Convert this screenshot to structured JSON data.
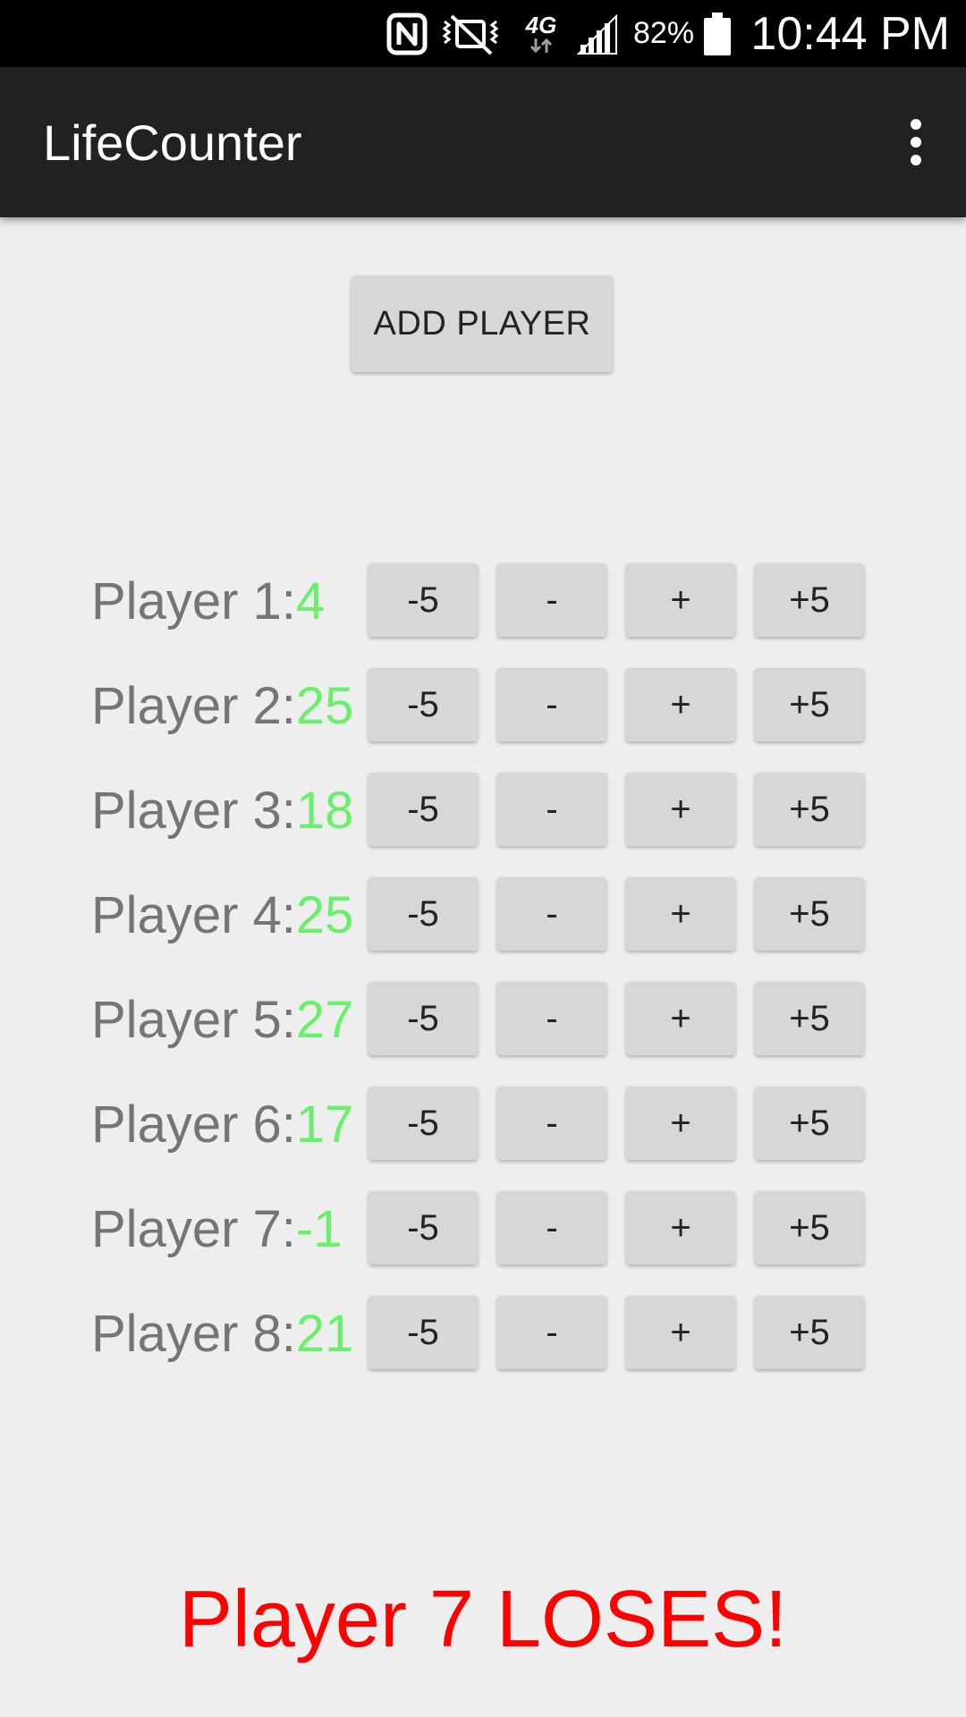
{
  "status_bar": {
    "battery_percent": "82%",
    "time": "10:44 PM",
    "icons": [
      "nfc-icon",
      "vibrate-icon",
      "network-4g-icon",
      "signal-icon",
      "battery-icon"
    ]
  },
  "app_bar": {
    "title": "LifeCounter",
    "overflow_icon": "more-vert-icon"
  },
  "add_player": {
    "label": "ADD PLAYER"
  },
  "buttons": {
    "minus_five": "-5",
    "minus_one": "-",
    "plus_one": "+",
    "plus_five": "+5"
  },
  "players": [
    {
      "label": "Player 1:",
      "life": "4"
    },
    {
      "label": "Player 2:",
      "life": "25"
    },
    {
      "label": "Player 3:",
      "life": "18"
    },
    {
      "label": "Player 4:",
      "life": "25"
    },
    {
      "label": "Player 5:",
      "life": "27"
    },
    {
      "label": "Player 6:",
      "life": "17"
    },
    {
      "label": "Player 7:",
      "life": "-1"
    },
    {
      "label": "Player 8:",
      "life": "21"
    }
  ],
  "loser_message": "Player 7 LOSES!",
  "colors": {
    "life_value": "#69f06a",
    "loser_text": "#ff0000",
    "app_bar": "#212121",
    "button_bg": "#d6d7d7"
  }
}
